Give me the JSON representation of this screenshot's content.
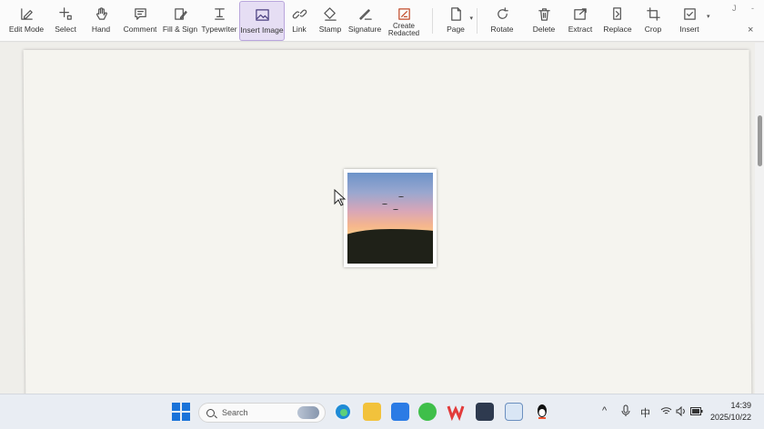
{
  "toolbar": {
    "tools": [
      {
        "id": "edit-mode",
        "label": "Edit Mode",
        "icon": "edit-mode-icon"
      },
      {
        "id": "select",
        "label": "Select",
        "icon": "select-icon"
      },
      {
        "id": "hand",
        "label": "Hand",
        "icon": "hand-icon"
      },
      {
        "id": "comment",
        "label": "Comment",
        "icon": "comment-icon"
      },
      {
        "id": "fill-sign",
        "label": "Fill & Sign",
        "icon": "fill-sign-icon"
      },
      {
        "id": "typewriter",
        "label": "Typewriter",
        "icon": "typewriter-icon"
      },
      {
        "id": "insert-image",
        "label": "Insert Image",
        "icon": "insert-image-icon",
        "active": true
      },
      {
        "id": "link",
        "label": "Link",
        "icon": "link-icon"
      },
      {
        "id": "stamp",
        "label": "Stamp",
        "icon": "stamp-icon"
      },
      {
        "id": "signature",
        "label": "Signature",
        "icon": "signature-icon"
      },
      {
        "id": "create-redacted",
        "label": "Create Redacted",
        "icon": "redact-icon"
      },
      {
        "id": "page",
        "label": "Page",
        "icon": "page-icon"
      },
      {
        "id": "rotate",
        "label": "Rotate",
        "icon": "rotate-icon"
      },
      {
        "id": "delete",
        "label": "Delete",
        "icon": "trash-icon"
      },
      {
        "id": "extract",
        "label": "Extract",
        "icon": "extract-icon"
      },
      {
        "id": "replace",
        "label": "Replace",
        "icon": "replace-icon"
      },
      {
        "id": "crop",
        "label": "Crop",
        "icon": "crop-icon"
      },
      {
        "id": "insert",
        "label": "Insert",
        "icon": "insert-icon"
      }
    ]
  },
  "taskbar": {
    "search_placeholder": "Search",
    "apps": [
      "windows-start-icon",
      "edge-icon",
      "file-explorer-icon",
      "app-store-icon",
      "wechat-icon",
      "wps-icon",
      "store-icon",
      "mail-icon",
      "qq-icon"
    ],
    "tray": {
      "chevron": "^",
      "ime": "中"
    },
    "time": "14:39",
    "date": "2025/10/22"
  },
  "colors": {
    "accent": "#e6def4",
    "accent_border": "#b9a6dc"
  }
}
